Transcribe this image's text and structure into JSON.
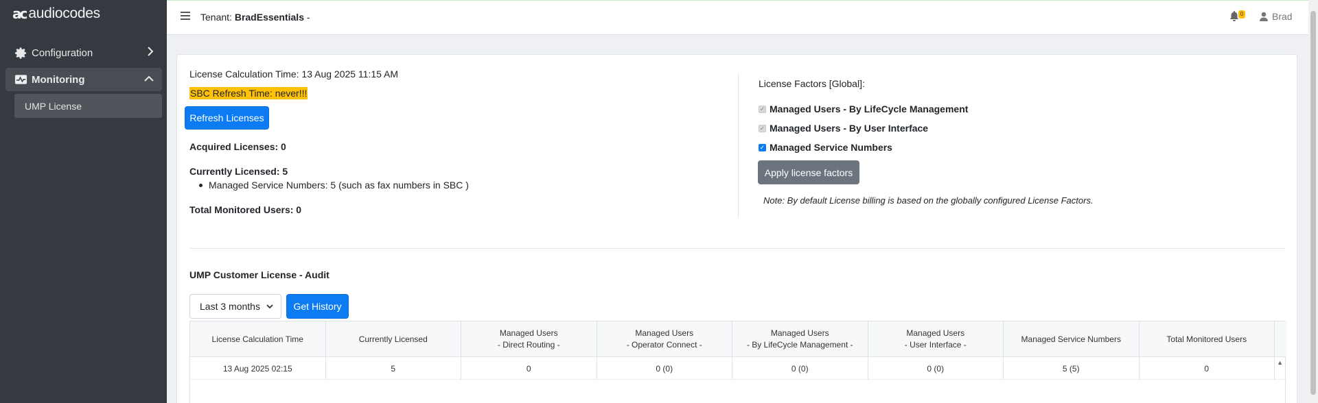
{
  "brand": {
    "logo_mark": "ac",
    "logo_text": "audiocodes"
  },
  "sidebar": {
    "items": [
      {
        "label": "Configuration",
        "icon": "gear-icon",
        "expanded": false
      },
      {
        "label": "Monitoring",
        "icon": "monitoring-icon",
        "expanded": true,
        "children": [
          {
            "label": "UMP License",
            "active": true
          }
        ]
      }
    ]
  },
  "header": {
    "tenant_label": "Tenant:",
    "tenant_name": "BradEssentials",
    "tenant_suffix": " -",
    "notifications_count": "0",
    "user_name": "Brad"
  },
  "license": {
    "calc_time": "License Calculation Time: 13 Aug 2025 11:15 AM",
    "sbc_refresh": "SBC Refresh Time: never!!!",
    "refresh_button": "Refresh Licenses",
    "acquired": "Acquired Licenses: 0",
    "currently": "Currently Licensed: 5",
    "currently_items": [
      "Managed Service Numbers: 5 (such as fax numbers in SBC )"
    ],
    "total_monitored": "Total Monitored Users: 0"
  },
  "factors": {
    "title": "License Factors [Global]:",
    "items": [
      {
        "label": "Managed Users - By LifeCycle Management",
        "checked": true,
        "disabled": true
      },
      {
        "label": "Managed Users - By User Interface",
        "checked": true,
        "disabled": true
      },
      {
        "label": "Managed Service Numbers",
        "checked": true,
        "disabled": false
      }
    ],
    "apply_button": "Apply license factors",
    "note": "Note: By default License billing is based on the globally configured License Factors."
  },
  "audit": {
    "title": "UMP Customer License - Audit",
    "period": "Last 3 months",
    "history_button": "Get History",
    "columns": [
      [
        "License Calculation Time"
      ],
      [
        "Currently Licensed"
      ],
      [
        "Managed Users",
        "- Direct Routing -"
      ],
      [
        "Managed Users",
        "- Operator Connect -"
      ],
      [
        "Managed Users",
        "- By LifeCycle Management -"
      ],
      [
        "Managed Users",
        "- User Interface -"
      ],
      [
        "Managed Service Numbers"
      ],
      [
        "Total Monitored Users"
      ]
    ],
    "rows": [
      [
        "13 Aug 2025 02:15",
        "5",
        "0",
        "0 (0)",
        "0 (0)",
        "0 (0)",
        "5 (5)",
        "0"
      ]
    ]
  },
  "colors": {
    "primary": "#0d7cf2",
    "sidebar": "#343a40",
    "highlight": "#ffc107",
    "secondary": "#6c757d"
  }
}
